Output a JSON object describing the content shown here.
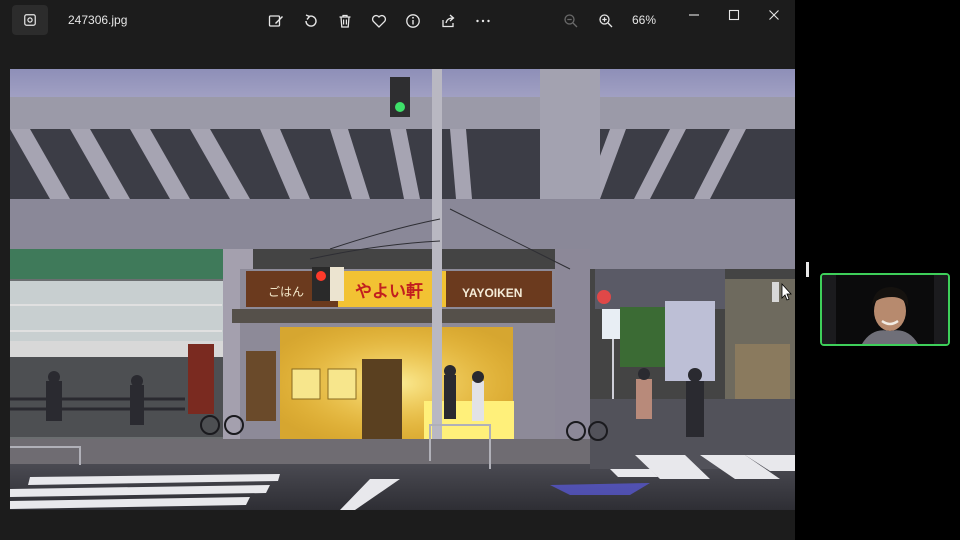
{
  "titlebar": {
    "file_name": "247306.jpg",
    "zoom_level": "66%",
    "tools": [
      {
        "icon": "edit-image-icon"
      },
      {
        "icon": "rotate-icon"
      },
      {
        "icon": "delete-icon"
      },
      {
        "icon": "favorite-heart-icon"
      },
      {
        "icon": "info-icon"
      },
      {
        "icon": "share-icon"
      },
      {
        "icon": "more-options-icon"
      }
    ]
  },
  "photo": {
    "sign_gohan": "ごはん",
    "sign_yayoi": "やよい軒",
    "sign_yayoiken": "YAYOIKEN",
    "sign_yayoi_small": "YAYOIKEN"
  },
  "colors": {
    "accent_green": "#3ecf5a",
    "window_bg": "#1c1c1c"
  }
}
